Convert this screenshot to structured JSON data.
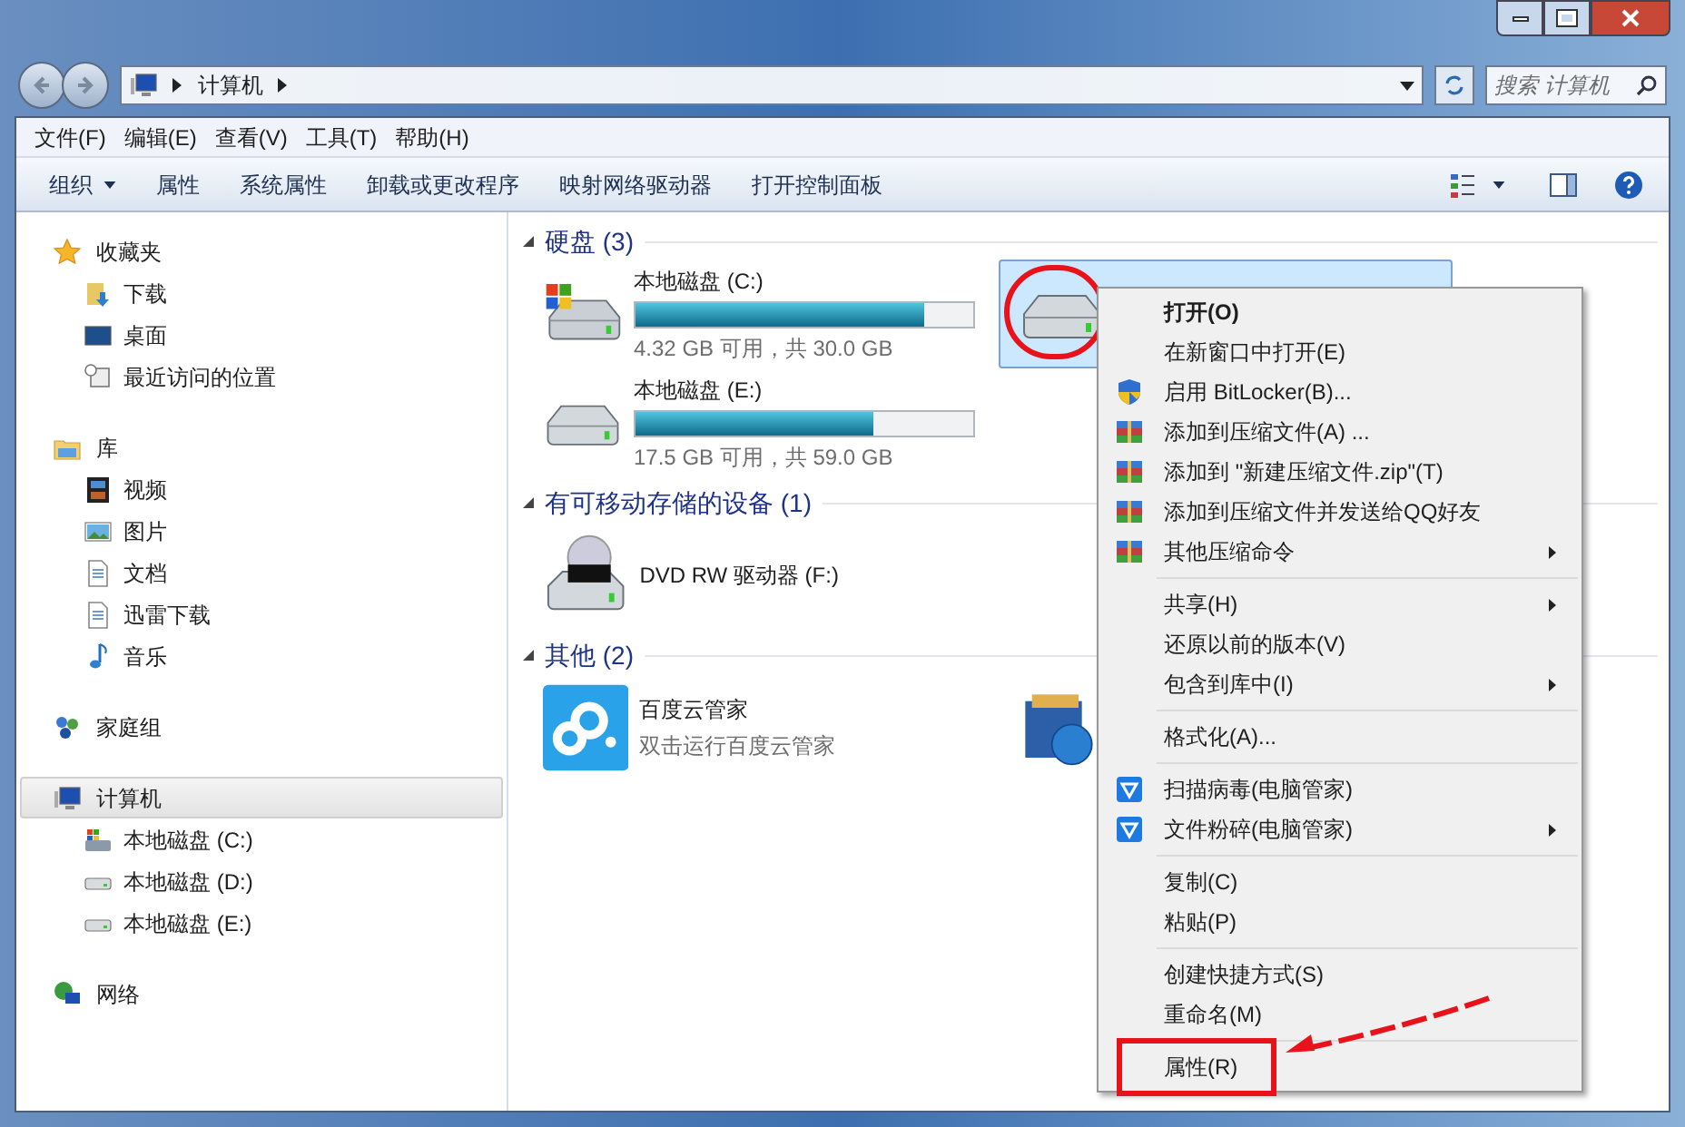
{
  "address_bar": {
    "path": [
      "计算机"
    ],
    "search_placeholder": "搜索 计算机"
  },
  "menu_bar": [
    "文件(F)",
    "编辑(E)",
    "查看(V)",
    "工具(T)",
    "帮助(H)"
  ],
  "toolbar": [
    {
      "label": "组织",
      "dropdown": true
    },
    {
      "label": "属性",
      "dropdown": false
    },
    {
      "label": "系统属性",
      "dropdown": false
    },
    {
      "label": "卸载或更改程序",
      "dropdown": false
    },
    {
      "label": "映射网络驱动器",
      "dropdown": false
    },
    {
      "label": "打开控制面板",
      "dropdown": false
    }
  ],
  "sidebar": [
    {
      "label": "收藏夹",
      "kind": "star",
      "selected": false,
      "children": [
        {
          "label": "下载",
          "kind": "download"
        },
        {
          "label": "桌面",
          "kind": "desktop"
        },
        {
          "label": "最近访问的位置",
          "kind": "recent"
        }
      ]
    },
    {
      "label": "库",
      "kind": "library",
      "selected": false,
      "children": [
        {
          "label": "视频",
          "kind": "video"
        },
        {
          "label": "图片",
          "kind": "picture"
        },
        {
          "label": "文档",
          "kind": "document"
        },
        {
          "label": "迅雷下载",
          "kind": "document"
        },
        {
          "label": "音乐",
          "kind": "music"
        }
      ]
    },
    {
      "label": "家庭组",
      "kind": "homegroup",
      "selected": false
    },
    {
      "label": "计算机",
      "kind": "computer",
      "selected": true,
      "children": [
        {
          "label": "本地磁盘 (C:)",
          "kind": "system-drive"
        },
        {
          "label": "本地磁盘 (D:)",
          "kind": "drive"
        },
        {
          "label": "本地磁盘 (E:)",
          "kind": "drive"
        }
      ]
    },
    {
      "label": "网络",
      "kind": "network",
      "selected": false
    }
  ],
  "groups": [
    {
      "title": "硬盘 (3)",
      "items": [
        {
          "kind": "system-drive",
          "name": "本地磁盘 (C:)",
          "level": 0.856,
          "info": "4.32 GB 可用，共 30.0 GB",
          "selected": false
        },
        {
          "kind": "drive",
          "selected": true,
          "circled": true
        },
        {
          "kind": "drive",
          "name": "本地磁盘 (E:)",
          "level": 0.703,
          "info": "17.5 GB 可用，共 59.0 GB",
          "selected": false
        }
      ]
    },
    {
      "title": "有可移动存储的设备 (1)",
      "items": [
        {
          "kind": "dvd",
          "name": "DVD RW 驱动器 (F:)",
          "selected": false
        }
      ]
    },
    {
      "title": "其他 (2)",
      "items": [
        {
          "kind": "cloud",
          "name": "百度云管家",
          "info": "双击运行百度云管家",
          "selected": false
        },
        {
          "kind": "network-folder",
          "selected": false
        }
      ]
    }
  ],
  "context_menu": [
    [
      {
        "label": "打开(O)",
        "default": true
      },
      {
        "label": "在新窗口中打开(E)"
      },
      {
        "label": "启用 BitLocker(B)...",
        "kind": "shield"
      },
      {
        "label": "添加到压缩文件(A) ...",
        "kind": "archive"
      },
      {
        "label": "添加到 \"新建压缩文件.zip\"(T)",
        "kind": "archive"
      },
      {
        "label": "添加到压缩文件并发送给QQ好友",
        "kind": "archive"
      },
      {
        "label": "其他压缩命令",
        "kind": "archive",
        "submenu": true
      }
    ],
    [
      {
        "label": "共享(H)",
        "submenu": true
      },
      {
        "label": "还原以前的版本(V)"
      },
      {
        "label": "包含到库中(I)",
        "submenu": true
      }
    ],
    [
      {
        "label": "格式化(A)..."
      }
    ],
    [
      {
        "label": "扫描病毒(电脑管家)",
        "kind": "guard"
      },
      {
        "label": "文件粉碎(电脑管家)",
        "kind": "guard",
        "submenu": true
      }
    ],
    [
      {
        "label": "复制(C)"
      },
      {
        "label": "粘贴(P)"
      }
    ],
    [
      {
        "label": "创建快捷方式(S)"
      },
      {
        "label": "重命名(M)"
      }
    ],
    [
      {
        "label": "属性(R)",
        "highlighted": true
      }
    ]
  ]
}
